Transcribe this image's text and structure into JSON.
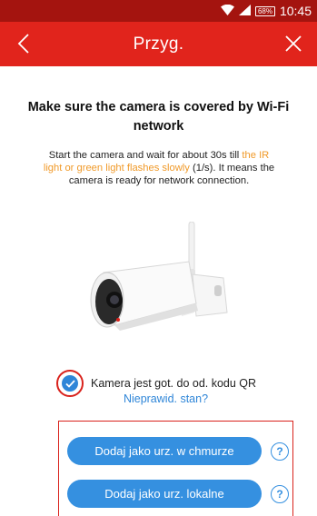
{
  "status_bar": {
    "battery": "68%",
    "time": "10:45"
  },
  "header": {
    "title": "Przyg."
  },
  "content": {
    "heading": "Make sure the camera is covered by Wi-Fi network",
    "desc_part1": "Start the camera and wait for about 30s till ",
    "desc_highlight": "the IR light or green light flashes slowly",
    "desc_part2": " (1/s). It means the camera is ready for network connection."
  },
  "checkbox": {
    "label": "Kamera jest got. do od. kodu QR",
    "checked": true
  },
  "link": {
    "label": "Nieprawid. stan?"
  },
  "buttons": {
    "cloud_label": "Dodaj jako urz. w chmurze",
    "local_label": "Dodaj jako urz. lokalne",
    "help_symbol": "?"
  },
  "colors": {
    "status_bar": "#a4140f",
    "header": "#e1241c",
    "accent_blue": "#3590e0",
    "highlight_orange": "#f09a2a",
    "annotation_red": "#d9221c"
  }
}
